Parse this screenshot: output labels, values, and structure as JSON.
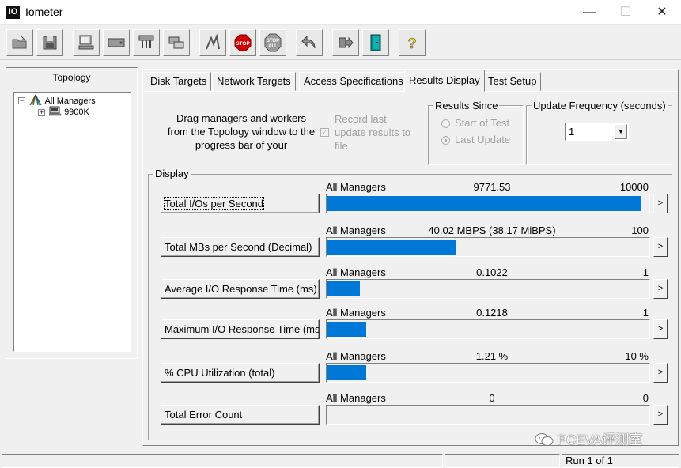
{
  "window": {
    "title": "Iometer",
    "logo": "IO"
  },
  "toolbar": {
    "buttons": [
      "open-config-icon",
      "save-config-icon",
      "new-disk-worker-icon",
      "new-network-worker-icon",
      "duplicate-worker-icon",
      "disconnect-icon",
      "start-tests-icon",
      "stop-icon",
      "stop-all-icon",
      "reset-workers-icon",
      "exit-icon",
      "quit-icon",
      "about-icon"
    ]
  },
  "topology": {
    "title": "Topology",
    "root": "All Managers",
    "child": "9900K"
  },
  "tabs": [
    {
      "label": "Disk Targets"
    },
    {
      "label": "Network Targets"
    },
    {
      "label": "Access Specifications"
    },
    {
      "label": "Results Display"
    },
    {
      "label": "Test Setup"
    }
  ],
  "results": {
    "instructions": "Drag managers and workers from the Topology window to the progress bar of your",
    "record_label": "Record last update results to file",
    "results_since": {
      "title": "Results Since",
      "options": [
        "Start of Test",
        "Last Update"
      ],
      "selected": "Last Update"
    },
    "update_frequency": {
      "title": "Update Frequency (seconds)",
      "value": "1"
    },
    "display_title": "Display",
    "metrics": [
      {
        "label": "Total I/Os per Second",
        "who": "All Managers",
        "value": "9771.53",
        "max": "10000",
        "fraction": 0.9772
      },
      {
        "label": "Total MBs per Second (Decimal)",
        "who": "All Managers",
        "value": "40.02 MBPS (38.17 MiBPS)",
        "max": "100",
        "fraction": 0.4002
      },
      {
        "label": "Average I/O Response Time (ms)",
        "who": "All Managers",
        "value": "0.1022",
        "max": "1",
        "fraction": 0.1022
      },
      {
        "label": "Maximum I/O Response Time (ms)",
        "who": "All Managers",
        "value": "0.1218",
        "max": "1",
        "fraction": 0.1218
      },
      {
        "label": "% CPU Utilization (total)",
        "who": "All Managers",
        "value": "1.21 %",
        "max": "10 %",
        "fraction": 0.121
      },
      {
        "label": "Total Error Count",
        "who": "All Managers",
        "value": "0",
        "max": "0",
        "fraction": 0
      }
    ],
    "more_label": ">"
  },
  "watermark": "PCEVA评测室",
  "status": {
    "run": "Run 1 of 1"
  },
  "colors": {
    "bar": "#0078d7"
  }
}
